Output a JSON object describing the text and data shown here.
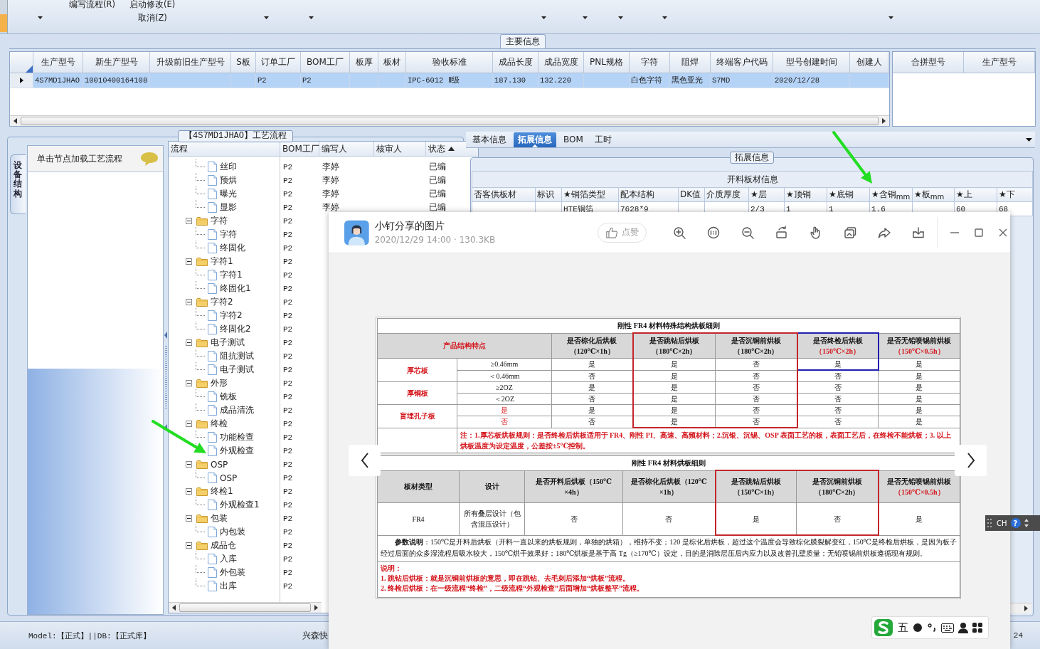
{
  "toolbar": {
    "menu_items": [
      {
        "label": "编写流程(R)"
      },
      {
        "label": "启动修改(E)"
      },
      {
        "label": "取消(Z)"
      }
    ]
  },
  "main_info": {
    "legend": "主要信息",
    "columns": [
      "生产型号",
      "新生产型号",
      "升级前旧生产型号",
      "S板",
      "订单工厂",
      "BOM工厂",
      "板厚",
      "板材",
      "验收标准",
      "成品长度",
      "成品宽度",
      "PNL规格",
      "字符",
      "阻焊",
      "终端客户代码",
      "型号创建时间",
      "创建人"
    ],
    "rows": [
      {
        "selected": true,
        "cells": [
          "4S7MD1JHAO",
          "10010400164108",
          null,
          null,
          "P2",
          "P2",
          null,
          null,
          "IPC-6012 Ⅱ级",
          "187.130",
          "132.220",
          null,
          "白色字符",
          "黑色亚光",
          "S7MD",
          "2020/12/28",
          null
        ]
      }
    ],
    "side_columns": [
      "合拼型号",
      "生产型号"
    ]
  },
  "process": {
    "title": "【4S7MD1JHAO】工艺流程",
    "side_tab": "设备结构",
    "hint": "单击节点加载工艺流程",
    "columns": [
      "流程",
      "BOM工厂",
      "编写人",
      "核审人",
      "状态"
    ],
    "tree": [
      {
        "kind": "doc",
        "label": "丝印",
        "bom": "P2",
        "author": "李婷",
        "status": "已编"
      },
      {
        "kind": "doc",
        "label": "预烘",
        "bom": "P2",
        "author": "李婷",
        "status": "已编"
      },
      {
        "kind": "doc",
        "label": "曝光",
        "bom": "P2",
        "author": "李婷",
        "status": "已编"
      },
      {
        "kind": "doc",
        "label": "显影",
        "bom": "P2",
        "author": "李婷",
        "status": "已编"
      },
      {
        "kind": "folder",
        "label": "字符",
        "bom": "P2",
        "expanded": true,
        "children": [
          {
            "kind": "doc",
            "label": "字符",
            "bom": "P2"
          },
          {
            "kind": "doc",
            "label": "终固化",
            "bom": "P2"
          }
        ]
      },
      {
        "kind": "folder",
        "label": "字符1",
        "bom": "P2",
        "expanded": true,
        "children": [
          {
            "kind": "doc",
            "label": "字符1",
            "bom": "P2"
          },
          {
            "kind": "doc",
            "label": "终固化1",
            "bom": "P2"
          }
        ]
      },
      {
        "kind": "folder",
        "label": "字符2",
        "bom": "P2",
        "expanded": true,
        "children": [
          {
            "kind": "doc",
            "label": "字符2",
            "bom": "P2"
          },
          {
            "kind": "doc",
            "label": "终固化2",
            "bom": "P2"
          }
        ]
      },
      {
        "kind": "folder",
        "label": "电子测试",
        "bom": "P2",
        "expanded": true,
        "children": [
          {
            "kind": "doc",
            "label": "阻抗测试",
            "bom": "P2"
          },
          {
            "kind": "doc",
            "label": "电子测试",
            "bom": "P2"
          }
        ]
      },
      {
        "kind": "folder",
        "label": "外形",
        "bom": "P2",
        "expanded": true,
        "children": [
          {
            "kind": "doc",
            "label": "铣板",
            "bom": "P2"
          },
          {
            "kind": "doc",
            "label": "成品清洗",
            "bom": "P2"
          }
        ]
      },
      {
        "kind": "folder",
        "label": "终检",
        "bom": "P2",
        "expanded": true,
        "children": [
          {
            "kind": "doc",
            "label": "功能检查",
            "bom": "P2"
          },
          {
            "kind": "doc",
            "label": "外观检查",
            "bom": "P2"
          }
        ]
      },
      {
        "kind": "folder",
        "label": "OSP",
        "bom": "P2",
        "expanded": true,
        "children": [
          {
            "kind": "doc",
            "label": "OSP",
            "bom": "P2"
          }
        ]
      },
      {
        "kind": "folder",
        "label": "终检1",
        "bom": "P2",
        "expanded": true,
        "children": [
          {
            "kind": "doc",
            "label": "外观检查1",
            "bom": "P2"
          }
        ]
      },
      {
        "kind": "folder",
        "label": "包装",
        "bom": "P2",
        "expanded": true,
        "children": [
          {
            "kind": "doc",
            "label": "内包装",
            "bom": "P2"
          }
        ]
      },
      {
        "kind": "folder",
        "label": "成品仓",
        "bom": "P2",
        "expanded": true,
        "children": [
          {
            "kind": "doc",
            "label": "入库",
            "bom": "P2"
          },
          {
            "kind": "doc",
            "label": "外包装",
            "bom": "P2"
          },
          {
            "kind": "doc",
            "label": "出库",
            "bom": "P2"
          }
        ]
      }
    ]
  },
  "extended": {
    "tabs": [
      {
        "label": "基本信息",
        "selected": false
      },
      {
        "label": "拓展信息",
        "selected": true
      },
      {
        "label": "BOM",
        "selected": false
      },
      {
        "label": "工时",
        "selected": false
      }
    ],
    "legend": "拓展信息",
    "table_title": "开料板材信息",
    "columns": [
      "否客供板材",
      "标识",
      "★铜箔类型",
      "配本结构",
      "DK值",
      "介质厚度",
      "★层",
      "★顶铜",
      "★底铜",
      "★含铜$_{mm}$",
      "★板$_{mm}$",
      "★上",
      "★下"
    ],
    "rows": [
      [
        null,
        null,
        "HTE铜箔",
        "7628*9",
        null,
        null,
        "2/3",
        "1",
        "1",
        "1.6",
        null,
        "60",
        "68"
      ]
    ]
  },
  "status_bar": {
    "model": "Model:【正式】||DB:【正式库】",
    "company": "兴森快",
    "page": "24"
  },
  "viewer": {
    "title": "小钉分享的图片",
    "meta": "2020/12/29 14:00 · 130.3KB",
    "like": "点赞",
    "document": {
      "table_1": {
        "title": "刚性 FR4 材料特殊结构烘板细则",
        "feature_heading": "产品结构特点",
        "columns": [
          {
            "title": "是否棕化后烘板",
            "subtitle": "（120℃×1h）",
            "subtitle_red": false
          },
          {
            "title": "是否跳钻后烘板",
            "subtitle": "（180℃×2h）",
            "subtitle_red": false,
            "color": "#c3262b",
            "frame_full": true
          },
          {
            "title": "是否沉铜前烘板",
            "subtitle": "（180℃×2h）",
            "subtitle_red": false,
            "color": "#c3262b",
            "frame_full": true
          },
          {
            "title": "是否终检后烘板",
            "subtitle": "（150℃×2h）",
            "subtitle_red": true,
            "color": "#1f1fb0",
            "frame_full": false
          },
          {
            "title": "是否无铅喷锡前烘板",
            "subtitle": "（150℃×0.5h）",
            "subtitle_red": true
          }
        ],
        "groups": [
          {
            "name": "厚芯板",
            "rows": [
              {
                "condition": "≥0.46mm",
                "condition_red": false,
                "values": [
                  "是",
                  "是",
                  "否",
                  "是",
                  "是"
                ]
              },
              {
                "condition": "＜0.46mm",
                "condition_red": false,
                "values": [
                  "否",
                  "是",
                  "否",
                  "否",
                  "是"
                ]
              }
            ]
          },
          {
            "name": "厚铜板",
            "rows": [
              {
                "condition": "≥2OZ",
                "condition_red": false,
                "values": [
                  "是",
                  "是",
                  "否",
                  "否",
                  "是"
                ]
              },
              {
                "condition": "＜2OZ",
                "condition_red": false,
                "values": [
                  "否",
                  "是",
                  "否",
                  "否",
                  "是"
                ]
              }
            ]
          },
          {
            "name": "盲埋孔子板",
            "rows": [
              {
                "condition": "是",
                "condition_red": true,
                "values": [
                  "是",
                  "是",
                  "否",
                  "否",
                  "是"
                ]
              },
              {
                "condition": "否",
                "condition_red": true,
                "values": [
                  "否",
                  "是",
                  "否",
                  "否",
                  "是"
                ]
              }
            ]
          }
        ],
        "note": "注：1.厚芯板烘板规则：是否终检后烘板适用于 FR4、刚性 PI、高速、高频材料；2.沉银、沉锡、OSP 表面工艺的板，表面工艺后，在终检不能烘板；3. 以上烘板温度为设定温度，公差按±5℃控制。"
      },
      "table_2": {
        "title": "刚性 FR4 材料烘板细则",
        "columns": [
          {
            "title": "板材类型"
          },
          {
            "title": "设计"
          },
          {
            "title": "是否开料后烘板（150℃",
            "subtitle": "×4h）",
            "subtitle_red": false
          },
          {
            "title": "是否棕化后烘板（120℃",
            "subtitle": "×1h）",
            "subtitle_red": false
          },
          {
            "title": "是否跳钻后烘板",
            "subtitle": "（150℃×1h）",
            "subtitle_red": false,
            "color": "#c3262b"
          },
          {
            "title": "是否沉铜前烘板",
            "subtitle": "（180℃×2h）",
            "subtitle_red": false,
            "color": "#c3262b"
          },
          {
            "title": "是否无铅喷锡前烘板",
            "subtitle": "（150℃×0.5h）",
            "subtitle_red": true
          }
        ],
        "rows": [
          [
            "FR4",
            "所有叠层设计（包含混压设计）",
            "否",
            "否",
            "是",
            "否",
            "是"
          ]
        ],
        "explanation": "**参数说明**：150℃是开料后烘板（开料一直以来的烘板规则，单独的烘箱），维持不变；120 是棕化后烘板，超过这个温度会导致棕化膜裂解变红，150℃是终检后烘板，是因为板子经过后面的众多湿流程后吸水较大，150℃烘干效果好；180℃烘板是基于高 Tg（≥170℃）设定，目的是消除层压后内应力以及改善孔壁质量；无铅喷锡前烘板遵循现有规则。",
        "notes": [
          "说明：",
          "1. 跳钻后烘板：就是沉铜前烘板的意思，即在跳钻、去毛刺后添加“烘板”流程。",
          "2. 终检后烘板：在一级流程“终检”，二级流程“外观检查”后面增加“烘板整平”流程。"
        ]
      }
    }
  },
  "ime": {
    "language": "CH",
    "help": "?",
    "input_mode": "五"
  }
}
